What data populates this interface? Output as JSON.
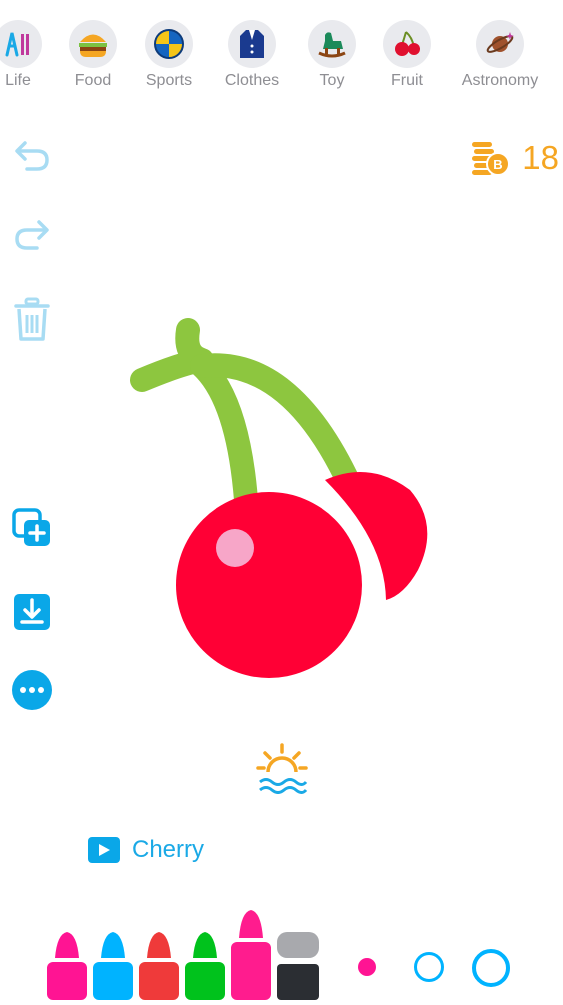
{
  "categories": [
    {
      "label": "Life",
      "icon": "life-icon"
    },
    {
      "label": "Food",
      "icon": "burger-icon"
    },
    {
      "label": "Sports",
      "icon": "volleyball-icon"
    },
    {
      "label": "Clothes",
      "icon": "jacket-icon"
    },
    {
      "label": "Toy",
      "icon": "rocking-horse-icon"
    },
    {
      "label": "Fruit",
      "icon": "cherry-icon"
    },
    {
      "label": "Astronomy",
      "icon": "planet-icon"
    }
  ],
  "toolbar": {
    "undo_icon": "undo-icon",
    "redo_icon": "redo-icon",
    "delete_icon": "trash-icon",
    "add_page_icon": "add-layer-icon",
    "download_icon": "download-icon",
    "more_icon": "more-icon"
  },
  "coins": {
    "count": "18",
    "icon": "coin-stack-icon",
    "color": "#f5a623"
  },
  "drawing": {
    "subject": "cherry",
    "stem_color": "#8dc63f",
    "fruit_color": "#ff0035",
    "highlight_color": "#f7a6c8"
  },
  "hint": {
    "icon": "sunrise-icon"
  },
  "word": {
    "text": "Cherry",
    "icon": "play-icon"
  },
  "palette": {
    "crayons": [
      {
        "name": "pink",
        "color": "#ff1493"
      },
      {
        "name": "blue",
        "color": "#00b3ff"
      },
      {
        "name": "red",
        "color": "#ef3a3a"
      },
      {
        "name": "green",
        "color": "#00c21c"
      },
      {
        "name": "magenta",
        "color": "#ff1c8e"
      },
      {
        "name": "black",
        "color": "#2b2e33"
      }
    ],
    "brush_sizes": [
      "small",
      "medium",
      "large"
    ],
    "accent": "#00b3ff"
  }
}
